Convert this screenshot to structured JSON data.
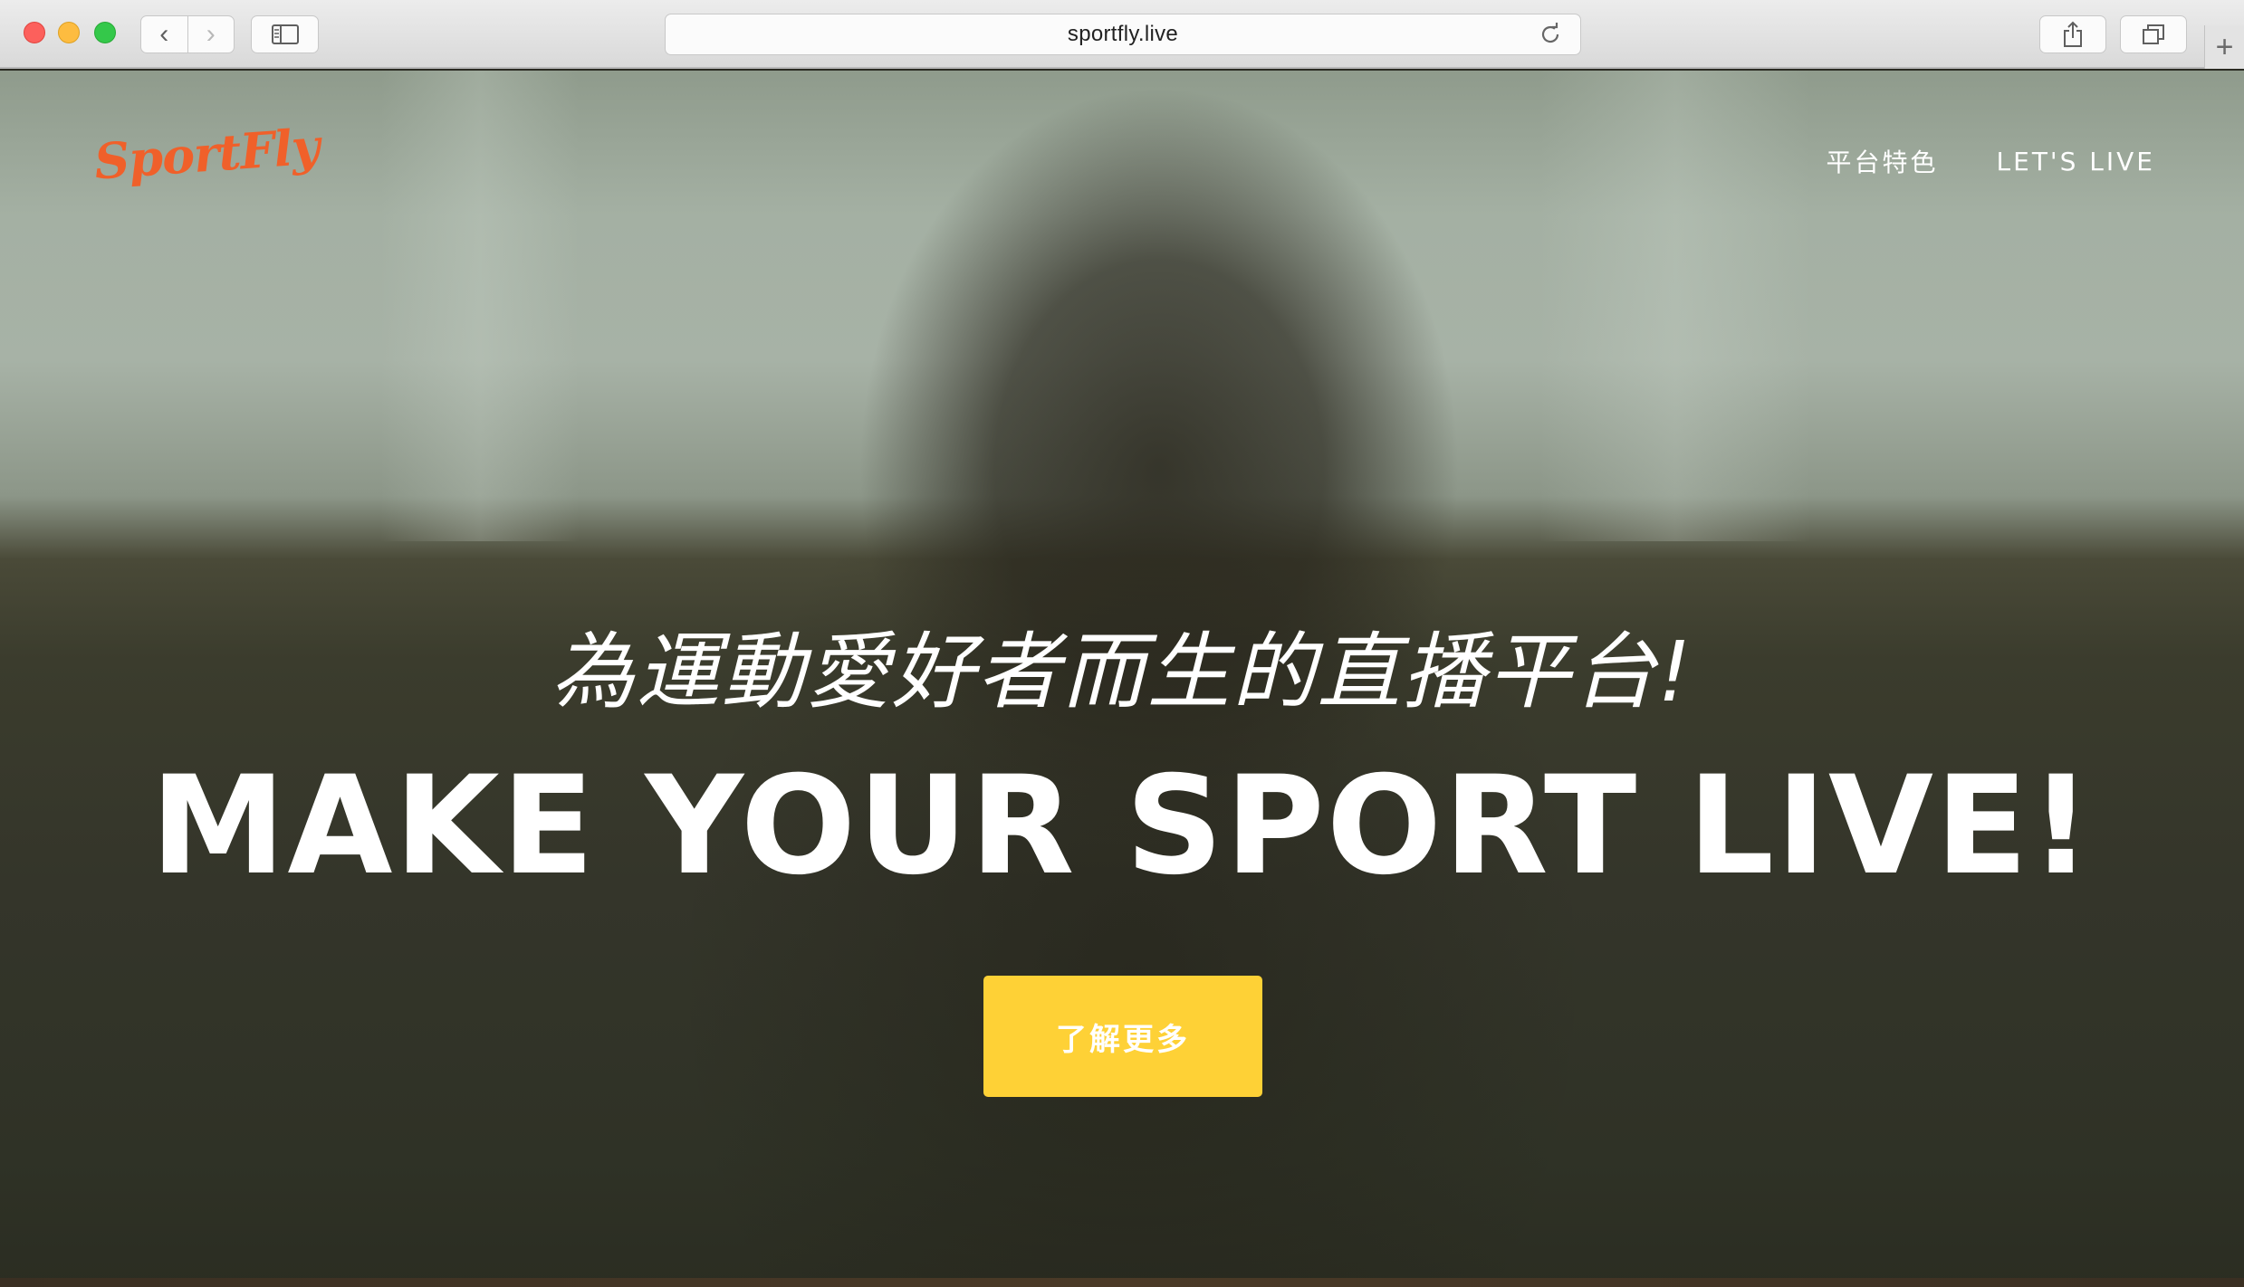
{
  "browser": {
    "url": "sportfly.live",
    "back_icon": "‹",
    "forward_icon": "›",
    "new_tab_icon": "+"
  },
  "site": {
    "logo": "SportFly",
    "nav": {
      "features": "平台特色",
      "lets_live": "LET'S LIVE"
    }
  },
  "hero": {
    "subtitle": "為運動愛好者而生的直播平台!",
    "headline": "MAKE YOUR SPORT LIVE!",
    "cta": "了解更多"
  },
  "colors": {
    "logo": "#f0602a",
    "cta_background": "#fed136"
  }
}
